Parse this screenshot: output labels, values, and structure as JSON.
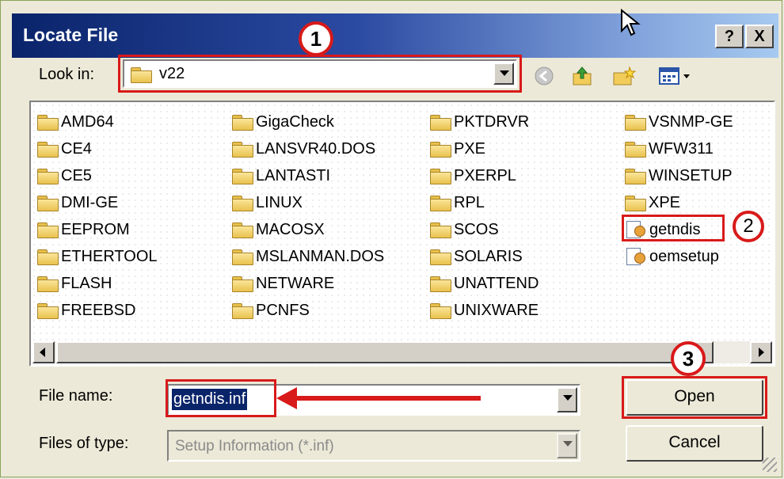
{
  "window": {
    "title": "Locate File",
    "help_label": "?",
    "close_label": "X"
  },
  "look_in": {
    "label": "Look in:",
    "value": "v22"
  },
  "callouts": [
    "1",
    "2",
    "3"
  ],
  "files": {
    "columns": [
      [
        {
          "name": "AMD64",
          "type": "folder"
        },
        {
          "name": "CE4",
          "type": "folder"
        },
        {
          "name": "CE5",
          "type": "folder"
        },
        {
          "name": "DMI-GE",
          "type": "folder"
        },
        {
          "name": "EEPROM",
          "type": "folder"
        },
        {
          "name": "ETHERTOOL",
          "type": "folder"
        },
        {
          "name": "FLASH",
          "type": "folder"
        },
        {
          "name": "FREEBSD",
          "type": "folder"
        }
      ],
      [
        {
          "name": "GigaCheck",
          "type": "folder"
        },
        {
          "name": "LANSVR40.DOS",
          "type": "folder"
        },
        {
          "name": "LANTASTI",
          "type": "folder"
        },
        {
          "name": "LINUX",
          "type": "folder"
        },
        {
          "name": "MACOSX",
          "type": "folder"
        },
        {
          "name": "MSLANMAN.DOS",
          "type": "folder"
        },
        {
          "name": "NETWARE",
          "type": "folder"
        },
        {
          "name": "PCNFS",
          "type": "folder"
        }
      ],
      [
        {
          "name": "PKTDRVR",
          "type": "folder"
        },
        {
          "name": "PXE",
          "type": "folder"
        },
        {
          "name": "PXERPL",
          "type": "folder"
        },
        {
          "name": "RPL",
          "type": "folder"
        },
        {
          "name": "SCOS",
          "type": "folder"
        },
        {
          "name": "SOLARIS",
          "type": "folder"
        },
        {
          "name": "UNATTEND",
          "type": "folder"
        },
        {
          "name": "UNIXWARE",
          "type": "folder"
        }
      ],
      [
        {
          "name": "VSNMP-GE",
          "type": "folder"
        },
        {
          "name": "WFW311",
          "type": "folder"
        },
        {
          "name": "WINSETUP",
          "type": "folder"
        },
        {
          "name": "XPE",
          "type": "folder"
        },
        {
          "name": "getndis",
          "type": "setup-info"
        },
        {
          "name": "oemsetup",
          "type": "setup-info"
        }
      ]
    ]
  },
  "file_name": {
    "label": "File name:",
    "value": "getndis.inf"
  },
  "file_type": {
    "label": "Files of type:",
    "value": "Setup Information (*.inf)"
  },
  "buttons": {
    "open": "Open",
    "cancel": "Cancel"
  },
  "colors": {
    "annotation": "#d81a1a",
    "title_bar": "#0a246a",
    "selection": "#0a246a"
  },
  "icons": {
    "back": "back-arrow-icon",
    "up": "up-folder-icon",
    "new_folder": "new-folder-icon",
    "view_menu": "view-menu-icon"
  }
}
